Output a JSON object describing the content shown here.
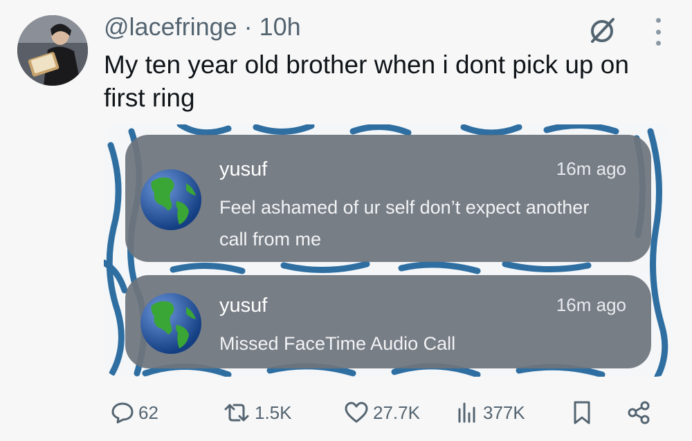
{
  "tweet": {
    "handle": "@lacefringe",
    "separator": "·",
    "time": "10h",
    "text": "My ten year old brother when i dont pick up on first ring"
  },
  "media": {
    "notifications": [
      {
        "sender": "yusuf",
        "time": "16m ago",
        "message": "Feel ashamed of ur self don’t expect another call from me",
        "icon": "globe-icon"
      },
      {
        "sender": "yusuf",
        "time": "16m ago",
        "message": "Missed FaceTime Audio Call",
        "icon": "globe-icon"
      }
    ]
  },
  "actions": {
    "replies": "62",
    "reposts": "1.5K",
    "likes": "27.7K",
    "views": "377K"
  },
  "icons": [
    "grok-icon",
    "more-icon",
    "reply-icon",
    "repost-icon",
    "like-icon",
    "views-icon",
    "bookmark-icon",
    "share-icon"
  ],
  "colors": {
    "text": "#0f1419",
    "secondary": "#536471",
    "notification_bg": "#6e747d"
  }
}
